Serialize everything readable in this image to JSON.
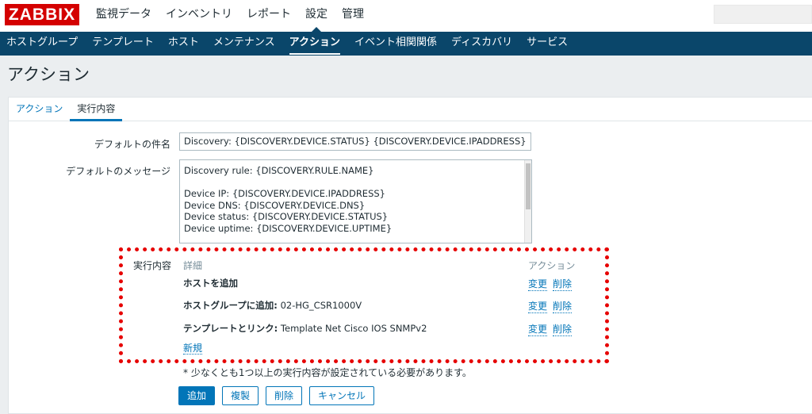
{
  "logo": "ZABBIX",
  "top_menu": [
    "監視データ",
    "インベントリ",
    "レポート",
    "設定",
    "管理"
  ],
  "top_menu_selected": "設定",
  "sub_menu": [
    "ホストグループ",
    "テンプレート",
    "ホスト",
    "メンテナンス",
    "アクション",
    "イベント相関関係",
    "ディスカバリ",
    "サービス"
  ],
  "sub_menu_selected": "アクション",
  "page_title": "アクション",
  "tabs": [
    "アクション",
    "実行内容"
  ],
  "active_tab": "実行内容",
  "form": {
    "subject_label": "デフォルトの件名",
    "subject_value": "Discovery: {DISCOVERY.DEVICE.STATUS} {DISCOVERY.DEVICE.IPADDRESS}",
    "message_label": "デフォルトのメッセージ",
    "message_value": "Discovery rule: {DISCOVERY.RULE.NAME}\n\nDevice IP: {DISCOVERY.DEVICE.IPADDRESS}\nDevice DNS: {DISCOVERY.DEVICE.DNS}\nDevice status: {DISCOVERY.DEVICE.STATUS}\nDevice uptime: {DISCOVERY.DEVICE.UPTIME}\n\nDevice service name: {DISCOVERY.SERVICE.NAME}",
    "operations_label": "実行内容"
  },
  "operations": {
    "header_details": "詳細",
    "header_action": "アクション",
    "rows": [
      {
        "bold": "ホストを追加",
        "rest": ""
      },
      {
        "bold": "ホストグループに追加:",
        "rest": " 02-HG_CSR1000V"
      },
      {
        "bold": "テンプレートとリンク:",
        "rest": " Template Net Cisco IOS SNMPv2"
      }
    ],
    "edit_label": "変更",
    "remove_label": "削除",
    "new_label": "新規"
  },
  "required_note": "* 少なくとも1つ以上の実行内容が設定されている必要があります。",
  "buttons": {
    "add": "追加",
    "clone": "複製",
    "delete": "削除",
    "cancel": "キャンセル"
  },
  "colors": {
    "logo": "#d40000",
    "submenu": "#0a466a",
    "link": "#0275b8",
    "highlight": "#e60000"
  }
}
